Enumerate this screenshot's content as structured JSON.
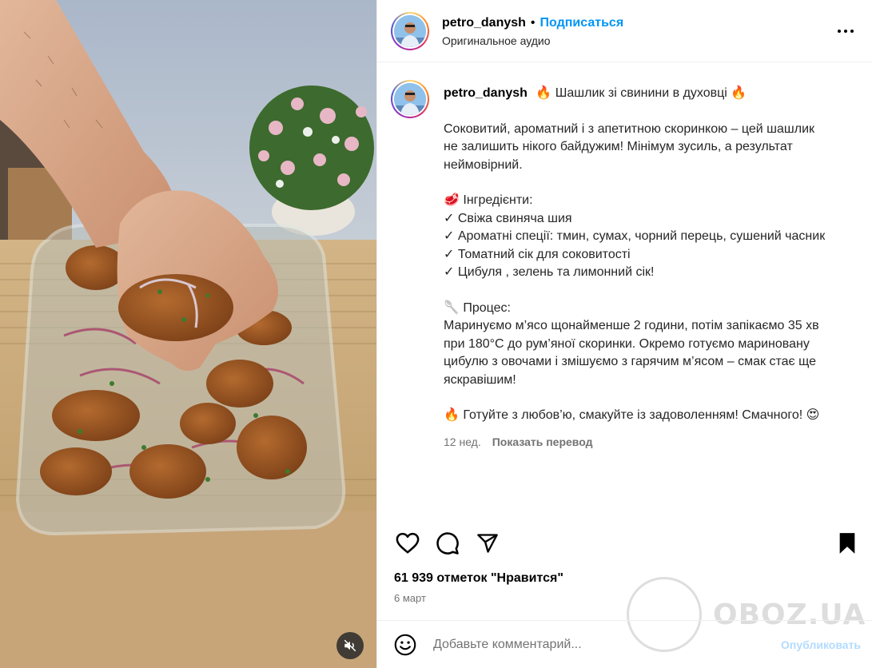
{
  "header": {
    "username": "petro_danysh",
    "separator": "•",
    "follow_label": "Подписаться",
    "audio_label": "Оригинальное аудио"
  },
  "caption": {
    "username": "petro_danysh",
    "title": "🔥 Шашлик зі свинини в духовці 🔥",
    "intro_lines": [
      "Соковитий, ароматний і з апетитною скоринкою – цей шашлик",
      "не залишить нікого байдужим! Мінімум зусиль, а результат",
      "неймовірний."
    ],
    "ingredients_heading": "🥩 Інгредієнти:",
    "ingredients": [
      "✓ Свіжа свиняча шия",
      "✓ Ароматні спеції: тмин, сумах, чорний перець, сушений часник",
      "✓ Томатний сік для соковитості",
      "✓ Цибуля , зелень та лимонний сік!"
    ],
    "process_heading": "🥄 Процес:",
    "process_lines": [
      "Маринуємо м’ясо щонайменше 2 години, потім запікаємо 35 хв",
      "при 180°C до рум’яної скоринки. Окремо готуємо мариновану",
      "цибулю з овочами і змішуємо з гарячим м’ясом – смак стає ще",
      "яскравішим!"
    ],
    "outro": "🔥 Готуйте з любов’ю, смакуйте із задоволенням! Смачного! 😍",
    "age": "12 нед.",
    "translate_label": "Показать перевод"
  },
  "actions": {
    "like_icon": "heart-icon",
    "comment_icon": "comment-icon",
    "share_icon": "paper-plane-icon",
    "save_icon": "bookmark-icon"
  },
  "likes_text": "61 939 отметок \"Нравится\"",
  "date_text": "6 март",
  "comment": {
    "placeholder": "Добавьте комментарий...",
    "publish_label": "Опубликовать"
  },
  "watermark_text": "OBOZ.UA",
  "colors": {
    "accent": "#0095f6",
    "publish_disabled": "#b3dbff",
    "secondary_text": "#737373"
  }
}
